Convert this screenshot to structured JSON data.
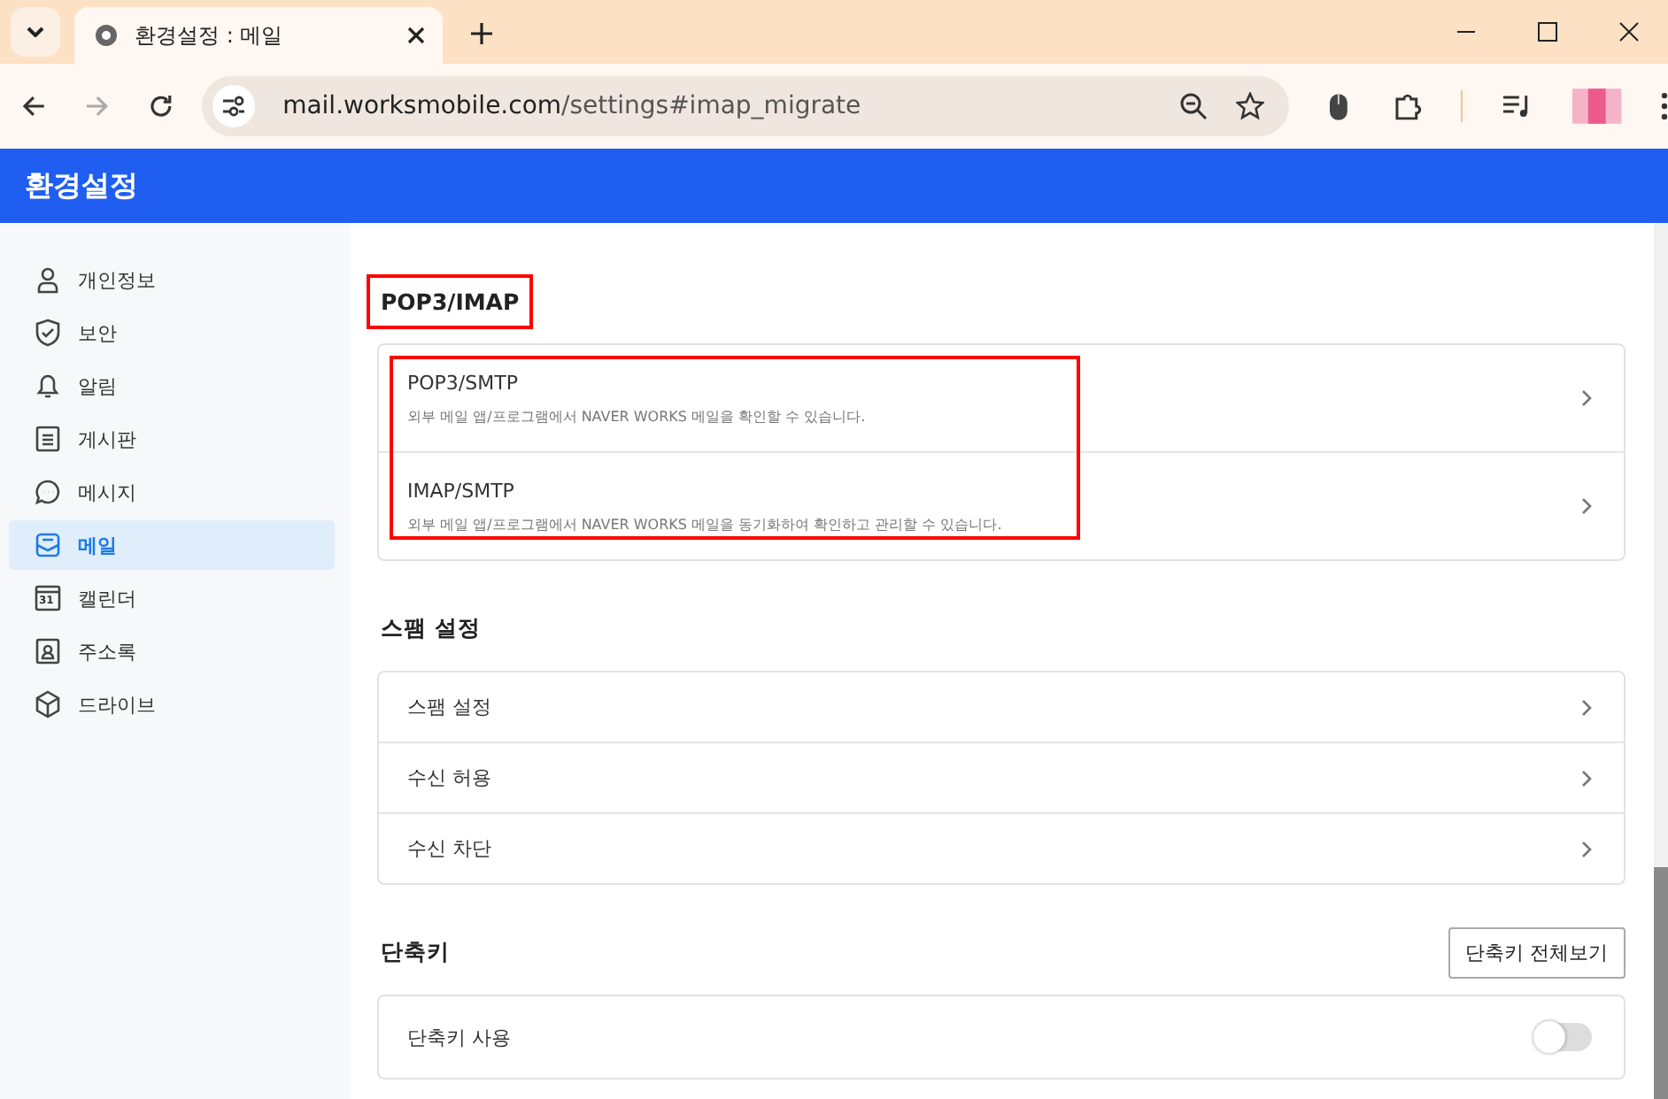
{
  "browser": {
    "tab_title": "환경설정 : 메일",
    "url_host": "mail.worksmobile.com",
    "url_path": "/settings#imap_migrate"
  },
  "app_header": {
    "title": "환경설정"
  },
  "sidebar": {
    "items": [
      {
        "label": "개인정보",
        "kind": "person",
        "selected": false
      },
      {
        "label": "보안",
        "kind": "shield",
        "selected": false
      },
      {
        "label": "알림",
        "kind": "bell",
        "selected": false
      },
      {
        "label": "게시판",
        "kind": "board",
        "selected": false
      },
      {
        "label": "메시지",
        "kind": "chat",
        "selected": false
      },
      {
        "label": "메일",
        "kind": "mail",
        "selected": true
      },
      {
        "label": "캘린더",
        "kind": "calendar",
        "selected": false,
        "icon_text": "31"
      },
      {
        "label": "주소록",
        "kind": "contacts",
        "selected": false
      },
      {
        "label": "드라이브",
        "kind": "cube",
        "selected": false
      }
    ]
  },
  "sections": [
    {
      "title": "POP3/IMAP",
      "highlighted": true,
      "rows_highlighted": true,
      "rows": [
        {
          "kind": "link",
          "label": "POP3/SMTP",
          "description": "외부 메일 앱/프로그램에서 NAVER WORKS 메일을 확인할 수 있습니다."
        },
        {
          "kind": "link",
          "label": "IMAP/SMTP",
          "description": "외부 메일 앱/프로그램에서 NAVER WORKS 메일을 동기화하여 확인하고 관리할 수 있습니다."
        }
      ]
    },
    {
      "title": "스팸 설정",
      "highlighted": false,
      "rows_highlighted": false,
      "rows": [
        {
          "kind": "link",
          "label": "스팸 설정"
        },
        {
          "kind": "link",
          "label": "수신 허용"
        },
        {
          "kind": "link",
          "label": "수신 차단"
        }
      ]
    },
    {
      "title": "단축키",
      "highlighted": false,
      "rows_highlighted": false,
      "action": "단축키 전체보기",
      "rows": [
        {
          "kind": "toggle",
          "label": "단축키 사용",
          "on": false
        }
      ]
    }
  ]
}
